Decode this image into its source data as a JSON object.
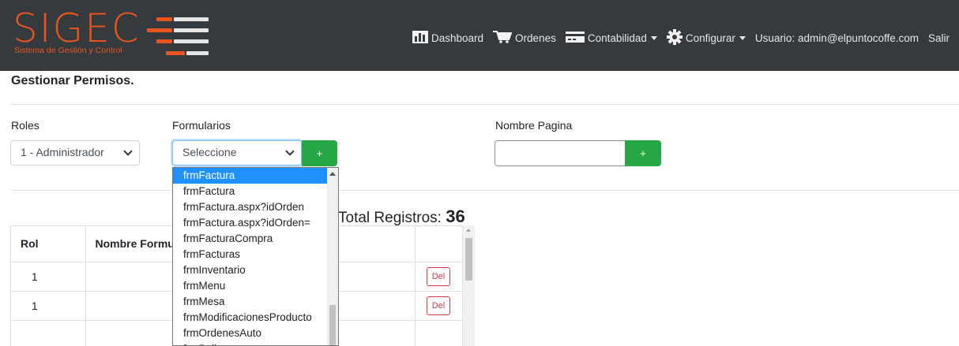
{
  "brand": {
    "name": "SIGEC",
    "subtitle": "Sistema de Gestión y Control",
    "color": "#e8541e"
  },
  "nav": [
    {
      "icon": "bar-chart-icon",
      "label": "Dashboard"
    },
    {
      "icon": "cart-icon",
      "label": "Ordenes"
    },
    {
      "icon": "credit-card-icon",
      "label": "Contabilidad",
      "dropdown": true
    },
    {
      "icon": "gear-icon",
      "label": "Configurar",
      "dropdown": true
    },
    {
      "label": "Usuario: admin@elpuntocoffe.com"
    },
    {
      "label": "Salir"
    }
  ],
  "page": {
    "title": "Gestionar Permisos."
  },
  "form": {
    "roles_label": "Roles",
    "roles_value": "1 - Administrador",
    "formularios_label": "Formularios",
    "formularios_value": "Seleccione",
    "add_label": "+",
    "nombre_label": "Nombre Pagina",
    "nombre_value": "",
    "add2_label": "+"
  },
  "total": {
    "label": "Total Registros:",
    "count": "36"
  },
  "table": {
    "headers": [
      "Rol",
      "Nombre Formulario"
    ],
    "rows": [
      {
        "rol": "1",
        "nombre": "",
        "action": "Del"
      },
      {
        "rol": "1",
        "nombre": "",
        "action": "Del"
      },
      {
        "rol": "",
        "nombre": "",
        "action": ""
      }
    ]
  },
  "dropdown_options": [
    "frmFactura",
    "frmFactura",
    "frmFactura.aspx?idOrden",
    "frmFactura.aspx?idOrden=",
    "frmFacturaCompra",
    "frmFacturas",
    "frmInventario",
    "frmMenu",
    "frmMesa",
    "frmModificacionesProducto",
    "frmOrdenesAuto",
    "frmPolizas"
  ],
  "selected_option_index": 0
}
